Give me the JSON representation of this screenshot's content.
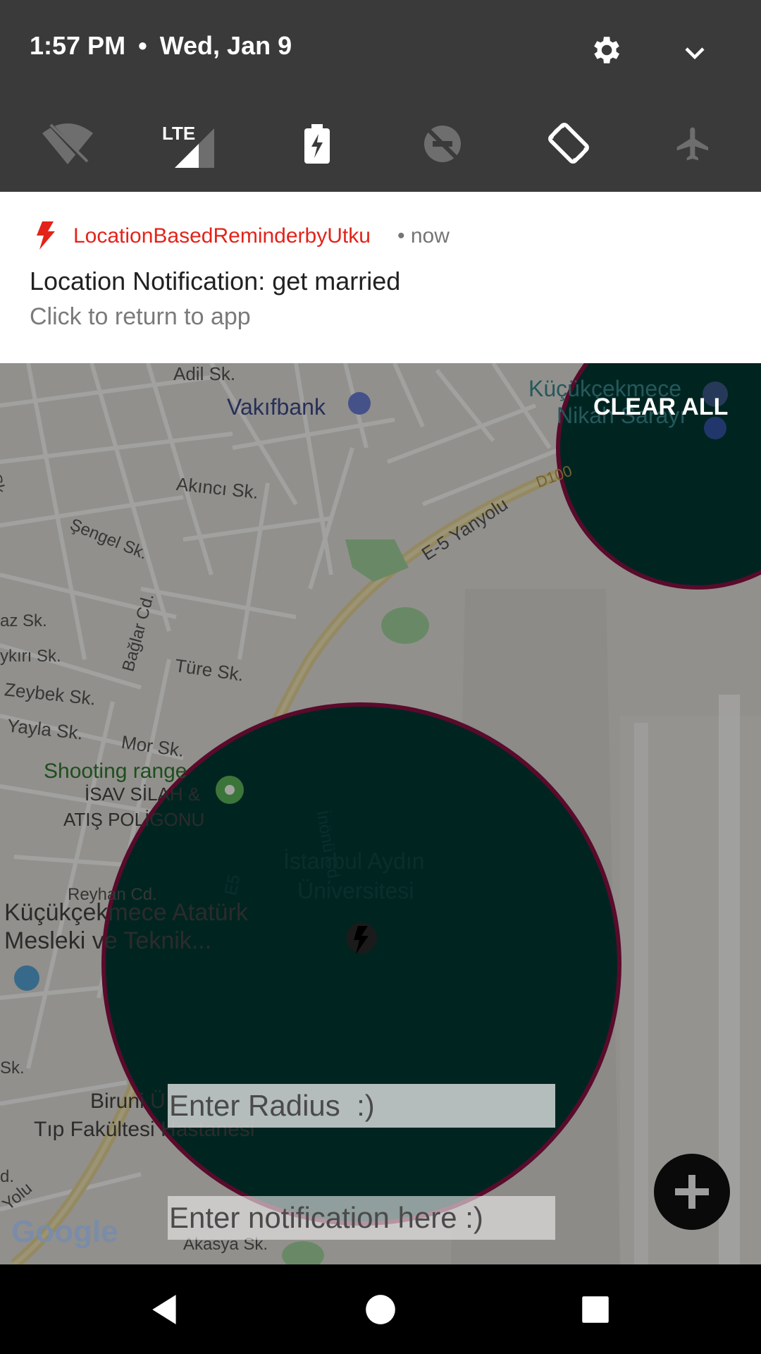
{
  "status_bar": {
    "time": "1:57 PM",
    "separator": "•",
    "date": "Wed, Jan 9"
  },
  "quick_settings": {
    "tiles": [
      {
        "icon": "wifi-off-icon",
        "label": ""
      },
      {
        "icon": "lte-signal-icon",
        "label": "LTE"
      },
      {
        "icon": "battery-saver-icon",
        "label": ""
      },
      {
        "icon": "do-not-disturb-off-icon",
        "label": ""
      },
      {
        "icon": "auto-rotate-icon",
        "label": ""
      },
      {
        "icon": "airplane-mode-icon",
        "label": ""
      }
    ]
  },
  "notification": {
    "app_name": "LocationBasedReminderbyUtku",
    "time": "• now",
    "title": "Location Notification: get married",
    "body": "Click to return to app",
    "accent": "#e3231a"
  },
  "clear_all_label": "CLEAR ALL",
  "map": {
    "labels": {
      "adil": "Adil Sk.",
      "vakifbank": "Vakıfbank",
      "kucukcekmece_nikah": "Küçükçekmece",
      "nikah_sarayi": "Nikah Sarayı",
      "ozdemir": "Özdemir Sk.",
      "akinci": "Akıncı Sk.",
      "yanyolu": "E-5 Yanyolu",
      "d100": "D100",
      "sengel": "Şengel Sk.",
      "baglar": "Bağlar Cd.",
      "az": "az Sk.",
      "ykiri": "ykırı Sk.",
      "ture": "Türe Sk.",
      "zeybek": "Zeybek Sk.",
      "yayla": "Yayla Sk.",
      "mor": "Mor Sk.",
      "shooting": "Shooting range",
      "isav1": "İSAV SİLAH &",
      "isav2": "ATIŞ POLİGONU",
      "inonu": "İnönü Cd.",
      "aydin1": "İstanbul Aydın",
      "aydin2": "Üniversitesi",
      "e5": "E5",
      "reyhan": "Reyhan Cd.",
      "kucukcekmece_ataturk": "Küçükçekmece Atatürk",
      "mesleki": "Mesleki ve Teknik...",
      "sk": "Sk.",
      "biruni": "Biruni Ü",
      "tip": "Tıp Fakültesi Hastanesi",
      "akasya": "Akasya Sk.",
      "yolu": "Yolu",
      "d": "d."
    },
    "google_logo": "Google",
    "circle_fill": "#003a35",
    "circle_stroke": "#8e1144"
  },
  "inputs": {
    "radius_placeholder": "Enter Radius  :)",
    "notification_placeholder": "Enter notification here :)"
  },
  "nav": {
    "back": "back-icon",
    "home": "home-icon",
    "recents": "recents-icon"
  }
}
